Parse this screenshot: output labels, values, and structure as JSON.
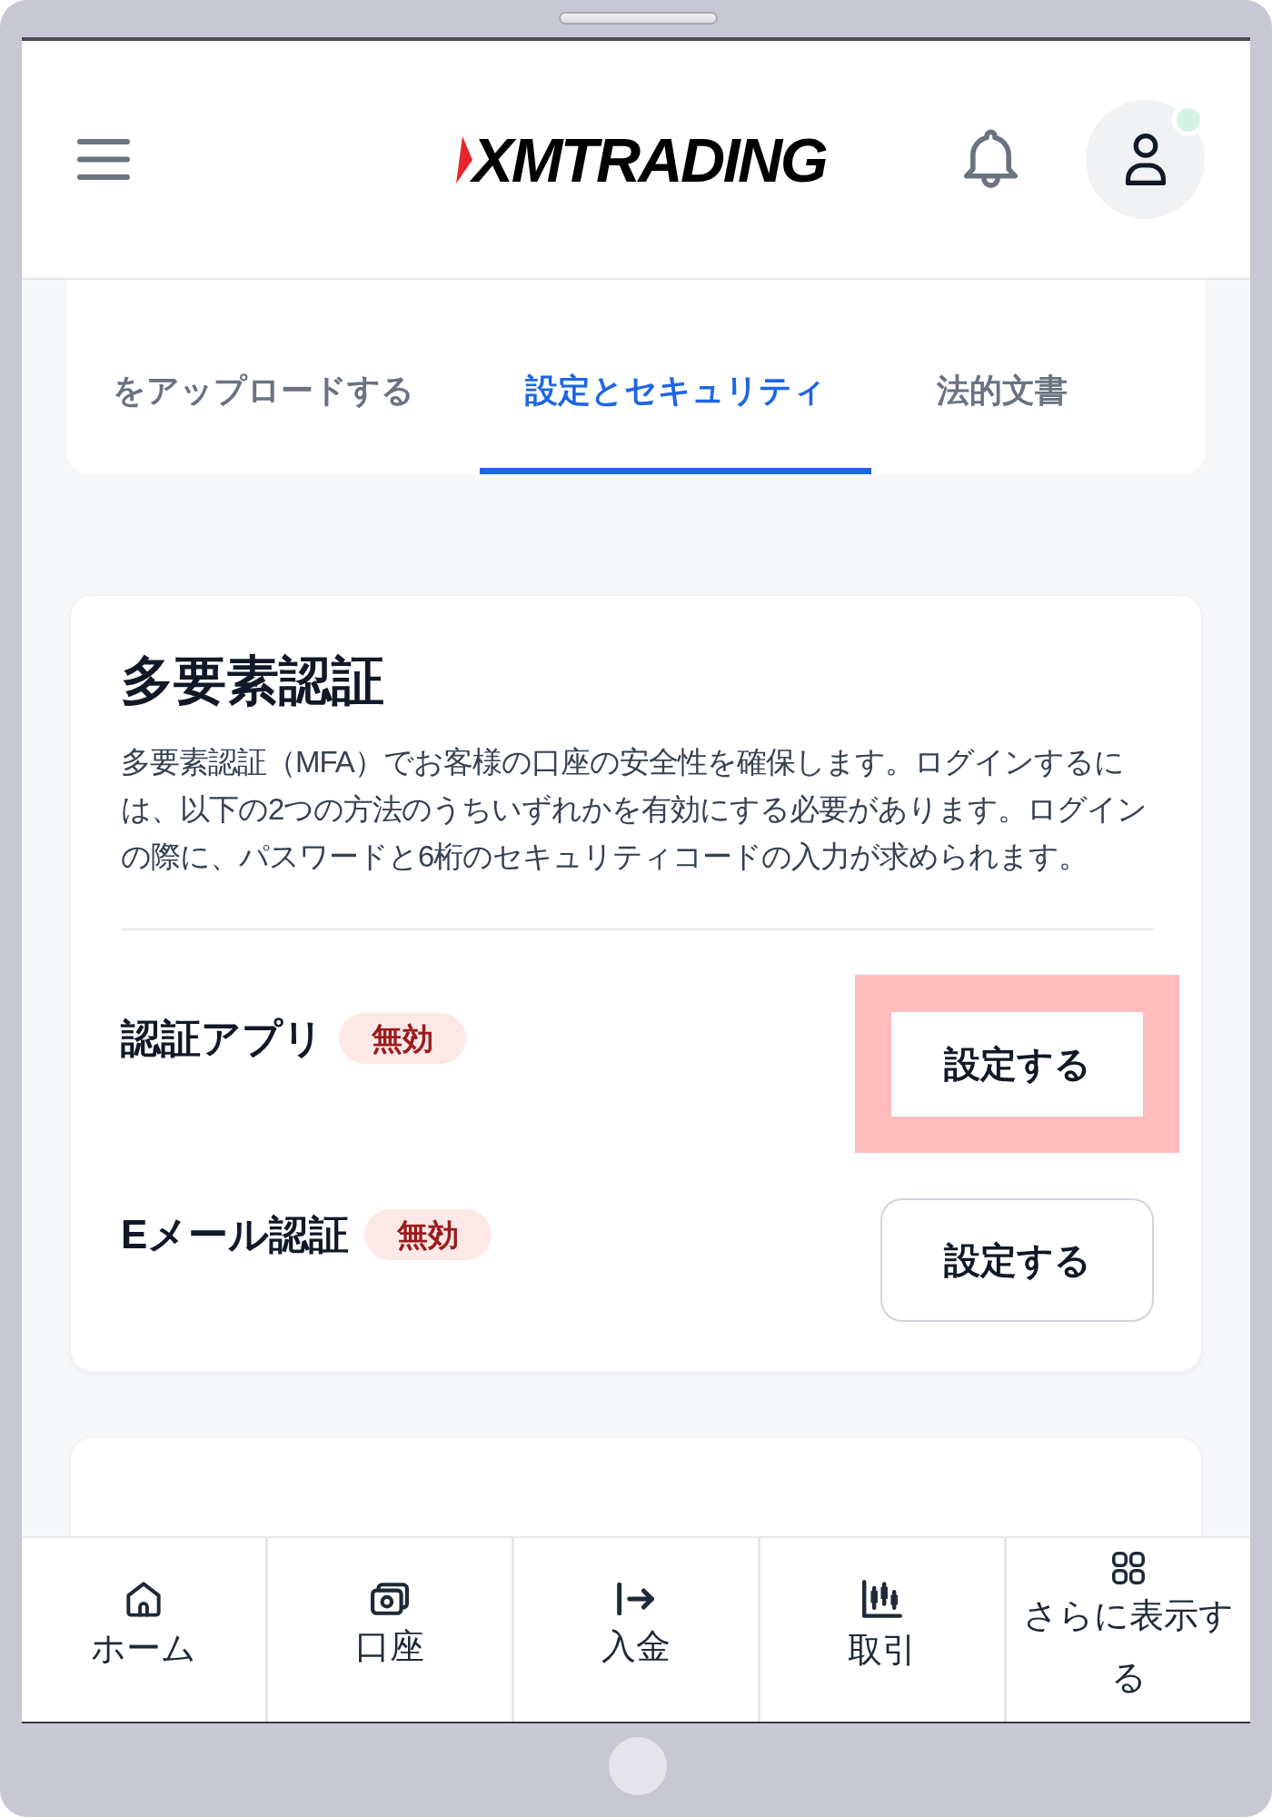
{
  "header": {
    "logo": "XMTRADING",
    "profile": {
      "online": true
    }
  },
  "tabs": [
    {
      "label": "をアップロードする",
      "selected": false
    },
    {
      "label": "設定とセキュリティ",
      "selected": true
    },
    {
      "label": "法的文書",
      "selected": false
    }
  ],
  "mfa": {
    "title": "多要素認証",
    "description": "多要素認証（MFA）でお客様の口座の安全性を確保します。ログインするには、以下の2つの方法のうちいずれかを有効にする必要があります。ログインの際に、パスワードと6桁のセキュリティコードの入力が求められます。",
    "methods": [
      {
        "name": "認証アプリ",
        "status": "無効",
        "action": "設定する",
        "highlighted": true
      },
      {
        "name": "Eメール認証",
        "status": "無効",
        "action": "設定する",
        "highlighted": false
      }
    ]
  },
  "bottom_nav": [
    {
      "kind": "home",
      "label": "ホーム"
    },
    {
      "kind": "account",
      "label": "口座"
    },
    {
      "kind": "deposit",
      "label": "入金"
    },
    {
      "kind": "trade",
      "label": "取引"
    },
    {
      "kind": "more",
      "label": "さらに表示する"
    }
  ]
}
